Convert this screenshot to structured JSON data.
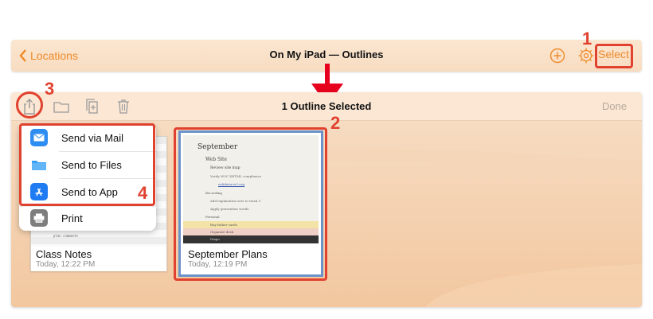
{
  "topbar": {
    "back_label": "Locations",
    "title": "On My iPad — Outlines",
    "select_label": "Select",
    "icons": [
      "add-icon",
      "gear-icon"
    ]
  },
  "panel": {
    "title": "1 Outline Selected",
    "done_label": "Done",
    "toolbar_icons": [
      "share-icon",
      "folder-icon",
      "duplicate-icon",
      "trash-icon"
    ]
  },
  "share_menu": {
    "items": [
      {
        "label": "Send via Mail",
        "icon": "mail-icon"
      },
      {
        "label": "Send to Files",
        "icon": "files-icon"
      },
      {
        "label": "Send to App",
        "icon": "app-store-icon"
      },
      {
        "label": "Print",
        "icon": "print-icon"
      }
    ]
  },
  "documents": [
    {
      "title": "Class Notes",
      "date": "Today, 12:22 PM"
    },
    {
      "title": "September Plans",
      "date": "Today, 12:19 PM"
    }
  ],
  "preview": {
    "heading": "September",
    "rows": [
      "Web Site",
      "Review site map",
      "Verify W3C XHTML compliance",
      "validator.w3.org",
      "Recording",
      "Add explanation sets to track 9",
      "Apply generation words",
      "Personal",
      "Buy father cards",
      "Organize desk",
      "Diapo"
    ]
  },
  "annotations": [
    "1",
    "2",
    "3",
    "4"
  ],
  "colors": {
    "accent": "#ef8a2a",
    "annotation": "#e0422f",
    "selection": "#6b93c9"
  }
}
